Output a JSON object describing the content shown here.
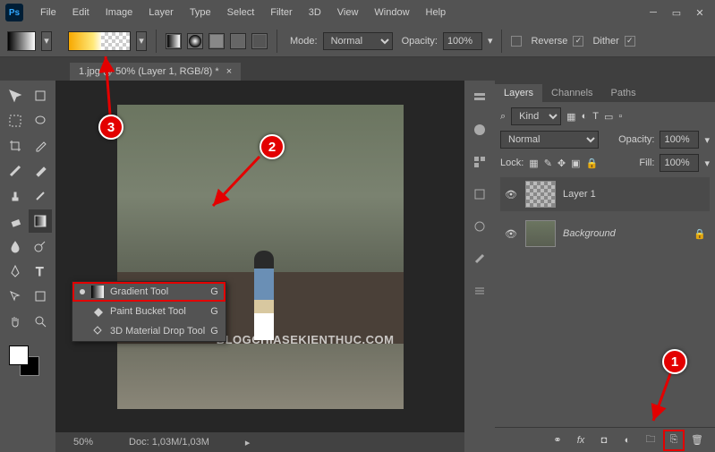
{
  "app": {
    "logo": "Ps"
  },
  "menu": [
    "File",
    "Edit",
    "Image",
    "Layer",
    "Type",
    "Select",
    "Filter",
    "3D",
    "View",
    "Window",
    "Help"
  ],
  "options": {
    "mode_label": "Mode:",
    "mode_value": "Normal",
    "opacity_label": "Opacity:",
    "opacity_value": "100%",
    "reverse_label": "Reverse",
    "dither_label": "Dither"
  },
  "document": {
    "tab_title": "1.jpg @ 50% (Layer 1, RGB/8) *",
    "zoom": "50%",
    "doc_info": "Doc: 1,03M/1,03M",
    "watermark": "BLOGCHIASEKIENTHUC.COM"
  },
  "tool_flyout": {
    "items": [
      {
        "label": "Gradient Tool",
        "shortcut": "G",
        "selected": true,
        "icon": "gradient-icon"
      },
      {
        "label": "Paint Bucket Tool",
        "shortcut": "G",
        "selected": false,
        "icon": "paint-bucket-icon"
      },
      {
        "label": "3D Material Drop Tool",
        "shortcut": "G",
        "selected": false,
        "icon": "material-drop-icon"
      }
    ]
  },
  "panels": {
    "tabs": [
      "Layers",
      "Channels",
      "Paths"
    ],
    "filter_label": "Kind",
    "blend_mode": "Normal",
    "opacity_label": "Opacity:",
    "opacity_value": "100%",
    "lock_label": "Lock:",
    "fill_label": "Fill:",
    "fill_value": "100%",
    "layers": [
      {
        "name": "Layer 1",
        "active": true,
        "locked": false,
        "thumb": "checker"
      },
      {
        "name": "Background",
        "active": false,
        "locked": true,
        "thumb": "photo"
      }
    ]
  },
  "annotations": {
    "n1": "1",
    "n2": "2",
    "n3": "3"
  }
}
